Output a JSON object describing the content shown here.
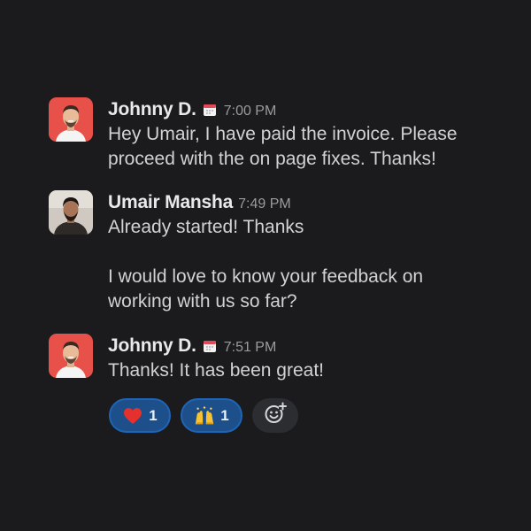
{
  "messages": [
    {
      "author": "Johnny D.",
      "has_status_icon": true,
      "time": "7:00 PM",
      "lines": [
        "Hey Umair, I have paid the invoice. Please",
        "proceed with the on page fixes. Thanks!"
      ]
    },
    {
      "author": "Umair Mansha",
      "has_status_icon": false,
      "time": "7:49 PM",
      "lines": [
        "Already started! Thanks",
        "",
        "I would love to know your feedback on",
        "working with us so far?"
      ]
    },
    {
      "author": "Johnny D.",
      "has_status_icon": true,
      "time": "7:51 PM",
      "lines": [
        "Thanks! It has been great!"
      ]
    }
  ],
  "reactions": [
    {
      "emoji": "heart-emoji",
      "count": "1"
    },
    {
      "emoji": "raising-hands-emoji",
      "count": "1"
    }
  ],
  "add_reaction_icon": "add-emoji-icon",
  "colors": {
    "background": "#1b1b1d",
    "reaction_bg": "#1d4f8a",
    "reaction_border": "#1e65b7",
    "avatar_johnny_bg": "#e8514a"
  }
}
